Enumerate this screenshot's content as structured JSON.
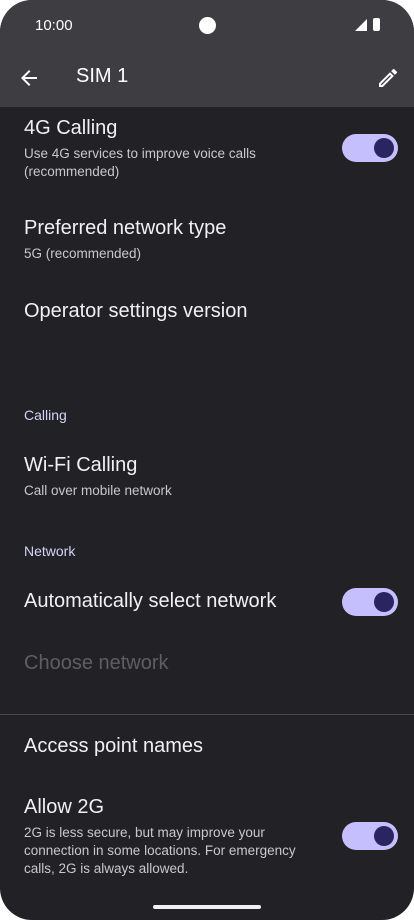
{
  "status_bar": {
    "time": "10:00"
  },
  "toolbar": {
    "title": "SIM 1"
  },
  "items": {
    "calling4g": {
      "title": "4G Calling",
      "subtitle": "Use 4G services to improve voice calls (recommended)",
      "toggle_on": true
    },
    "preferred_network": {
      "title": "Preferred network type",
      "subtitle": "5G (recommended)"
    },
    "operator_settings": {
      "title": "Operator settings version"
    },
    "wifi_calling": {
      "title": "Wi-Fi Calling",
      "subtitle": "Call over mobile network"
    },
    "auto_select": {
      "title": "Automatically select network",
      "toggle_on": true
    },
    "choose_network": {
      "title": "Choose network"
    },
    "apn": {
      "title": "Access point names"
    },
    "allow2g": {
      "title": "Allow 2G",
      "subtitle": "2G is less secure, but may improve your connection in some locations. For emergency calls, 2G is always allowed.",
      "toggle_on": true
    }
  },
  "sections": {
    "calling": "Calling",
    "network": "Network"
  },
  "colors": {
    "accent": "#c5bffd",
    "thumb": "#2a2560",
    "background": "#212126",
    "appbar": "#3e3e42"
  }
}
